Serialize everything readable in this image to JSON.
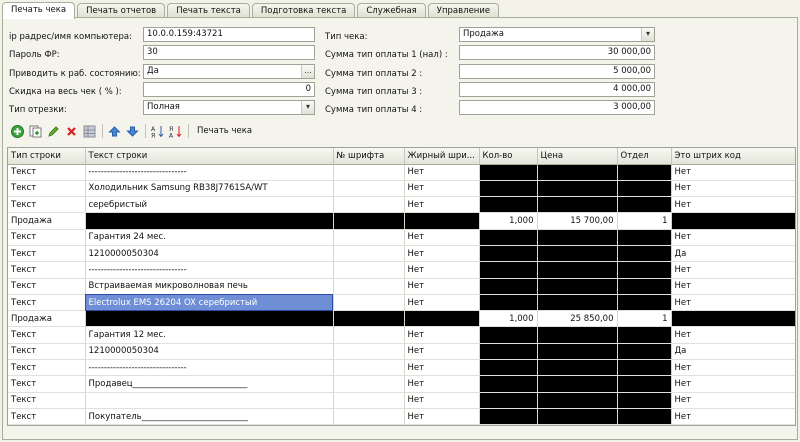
{
  "tabs": [
    "Печать чека",
    "Печать отчетов",
    "Печать текста",
    "Подготовка текста",
    "Служебная",
    "Управление"
  ],
  "form": {
    "ip_label": "ip радрес/имя компьютера:",
    "ip_value": "10.0.0.159:43721",
    "pass_label": "Пароль ФР:",
    "pass_value": "30",
    "ready_label": "Приводить к раб. состоянию:",
    "ready_value": "Да",
    "ready_btn": "...",
    "discount_label": "Скидка на весь чек ( % ):",
    "discount_value": "0",
    "cut_label": "Тип отрезки:",
    "cut_value": "Полная",
    "type_label": "Тип чека:",
    "type_value": "Продажа",
    "pay1_label": "Сумма тип оплаты 1 (нал) :",
    "pay1_value": "30 000,00",
    "pay2_label": "Сумма тип оплаты 2 :",
    "pay2_value": "5 000,00",
    "pay3_label": "Сумма тип оплаты 3 :",
    "pay3_value": "4 000,00",
    "pay4_label": "Сумма тип оплаты 4 :",
    "pay4_value": "3 000,00"
  },
  "toolbar": {
    "print_label": "Печать чека"
  },
  "table": {
    "headers": [
      "Тип строки",
      "Текст строки",
      "№ шрифта",
      "Жирный шри...",
      "Кол-во",
      "Цена",
      "Отдел",
      "Это штрих код"
    ],
    "rows": [
      [
        "Текст",
        "--------------------------------",
        "",
        "Нет",
        "",
        "",
        "",
        "Нет"
      ],
      [
        "Текст",
        "Холодильник Samsung RB38J7761SA/WT",
        "",
        "Нет",
        "",
        "",
        "",
        "Нет"
      ],
      [
        "Текст",
        "серебристый",
        "",
        "Нет",
        "",
        "",
        "",
        "Нет"
      ],
      [
        "Продажа",
        "",
        "",
        "",
        "1,000",
        "15 700,00",
        "1",
        ""
      ],
      [
        "Текст",
        "Гарантия 24 мес.",
        "",
        "Нет",
        "",
        "",
        "",
        "Нет"
      ],
      [
        "Текст",
        "1210000050304",
        "",
        "Нет",
        "",
        "",
        "",
        "Да"
      ],
      [
        "Текст",
        "--------------------------------",
        "",
        "Нет",
        "",
        "",
        "",
        "Нет"
      ],
      [
        "Текст",
        "Встраиваемая микроволновая печь",
        "",
        "Нет",
        "",
        "",
        "",
        "Нет"
      ],
      [
        "Текст",
        "Electrolux EMS 26204 OX серебристый",
        "",
        "Нет",
        "",
        "",
        "",
        "Нет"
      ],
      [
        "Продажа",
        "",
        "",
        "",
        "1,000",
        "25 850,00",
        "1",
        ""
      ],
      [
        "Текст",
        "Гарантия 12 мес.",
        "",
        "Нет",
        "",
        "",
        "",
        "Нет"
      ],
      [
        "Текст",
        "1210000050304",
        "",
        "Нет",
        "",
        "",
        "",
        "Да"
      ],
      [
        "Текст",
        "--------------------------------",
        "",
        "Нет",
        "",
        "",
        "",
        "Нет"
      ],
      [
        "Текст",
        "Продавец___________________________",
        "",
        "Нет",
        "",
        "",
        "",
        "Нет"
      ],
      [
        "Текст",
        "",
        "",
        "Нет",
        "",
        "",
        "",
        "Нет"
      ],
      [
        "Текст",
        "Покупатель_________________________",
        "",
        "Нет",
        "",
        "",
        "",
        "Нет"
      ]
    ],
    "selected_row": 8
  },
  "colors": {
    "selection": "#6f8ed6",
    "black_fill": "#000000",
    "background": "#f3f2e8"
  }
}
